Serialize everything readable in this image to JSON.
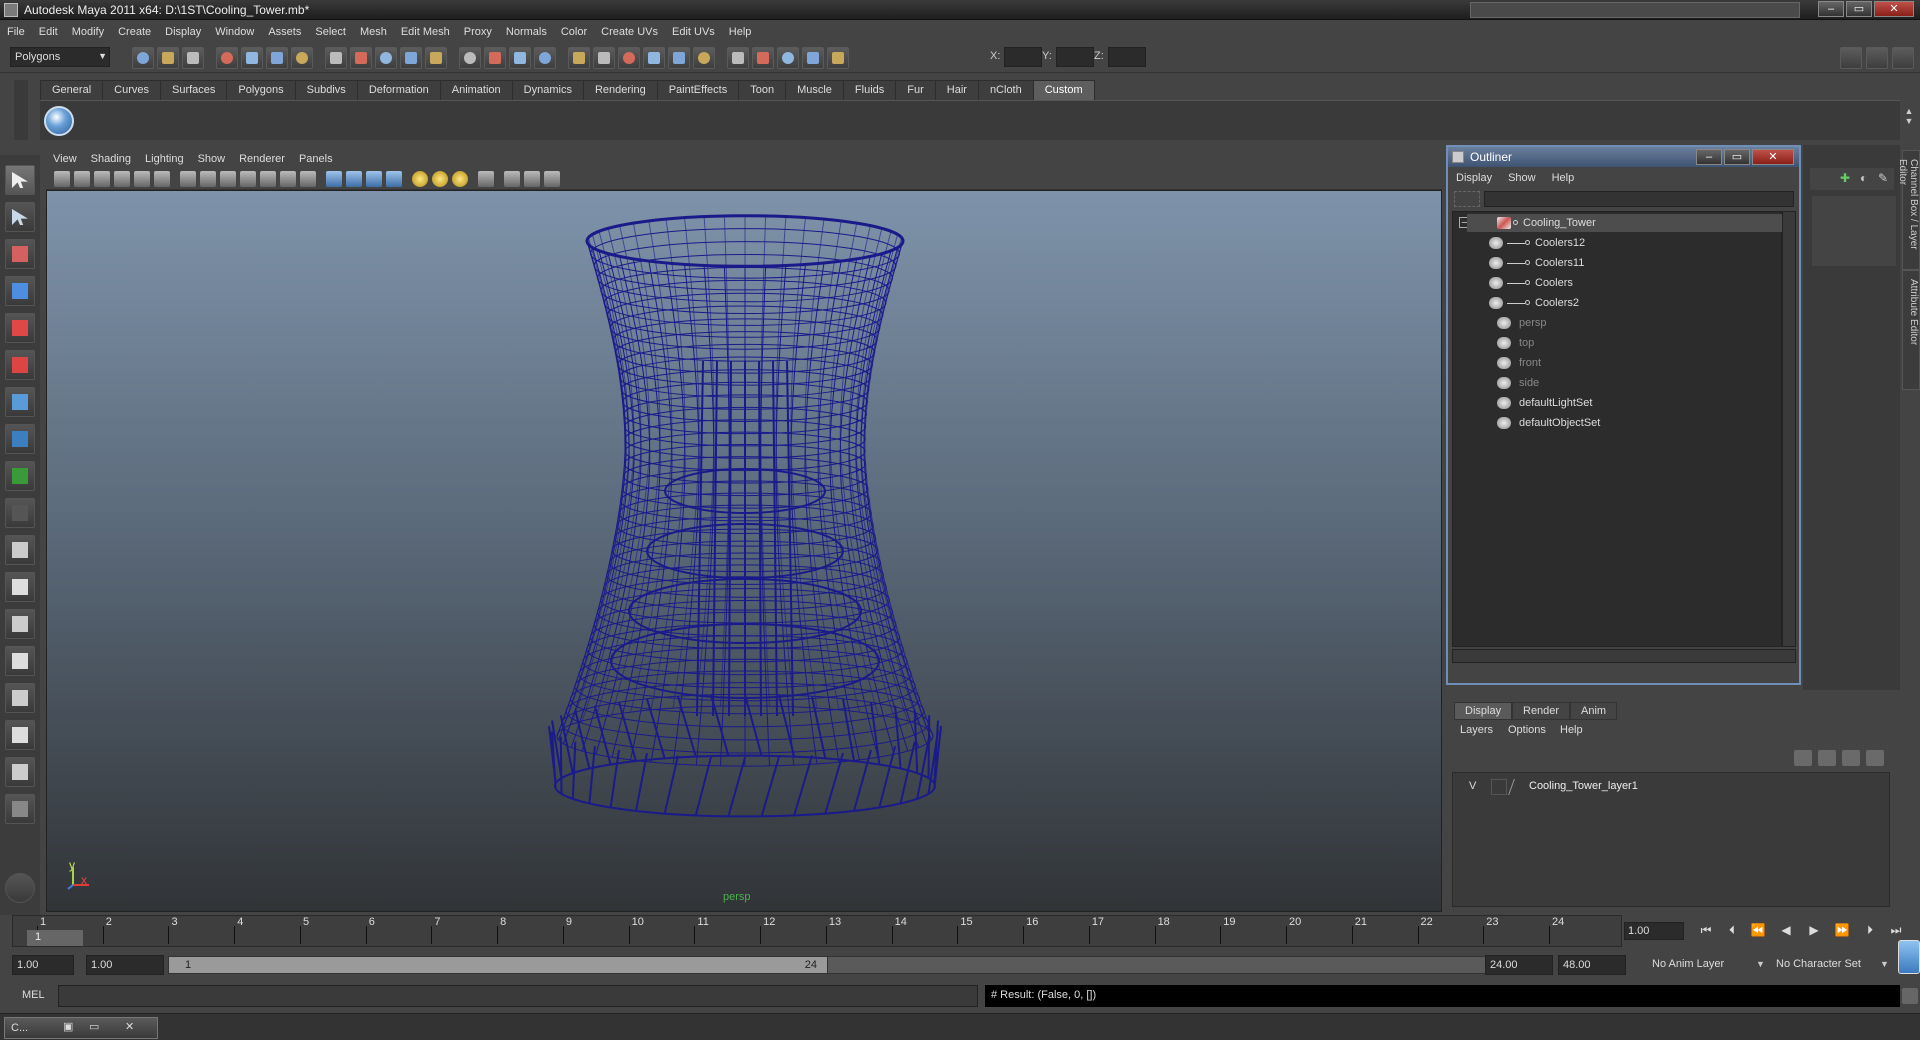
{
  "window": {
    "title": "Autodesk Maya 2011 x64: D:\\1ST\\Cooling_Tower.mb*",
    "controls": {
      "minimize": "–",
      "maximize": "▭",
      "close": "✕"
    }
  },
  "menubar": [
    "File",
    "Edit",
    "Modify",
    "Create",
    "Display",
    "Window",
    "Assets",
    "Select",
    "Mesh",
    "Edit Mesh",
    "Proxy",
    "Normals",
    "Color",
    "Create UVs",
    "Edit UVs",
    "Help"
  ],
  "statusline": {
    "mode": "Polygons",
    "x_label": "X:",
    "y_label": "Y:",
    "z_label": "Z:"
  },
  "shelf": {
    "tabs": [
      "General",
      "Curves",
      "Surfaces",
      "Polygons",
      "Subdivs",
      "Deformation",
      "Animation",
      "Dynamics",
      "Rendering",
      "PaintEffects",
      "Toon",
      "Muscle",
      "Fluids",
      "Fur",
      "Hair",
      "nCloth",
      "Custom"
    ],
    "active_tab": "Custom"
  },
  "viewport": {
    "menu": [
      "View",
      "Shading",
      "Lighting",
      "Show",
      "Renderer",
      "Panels"
    ],
    "camera": "persp",
    "axis_y": "y",
    "axis_x": "x",
    "wire_color": "#1a1a8a",
    "bg_top": "#7e93aa",
    "bg_bottom": "#313437"
  },
  "outliner": {
    "title": "Outliner",
    "menu": [
      "Display",
      "Show",
      "Help"
    ],
    "collapse_symbol": "–",
    "items": [
      {
        "label": "Cooling_Tower",
        "level": 0,
        "selected": true,
        "dim": false
      },
      {
        "label": "Coolers12",
        "level": 1,
        "selected": false,
        "dim": false
      },
      {
        "label": "Coolers11",
        "level": 1,
        "selected": false,
        "dim": false
      },
      {
        "label": "Coolers",
        "level": 1,
        "selected": false,
        "dim": false
      },
      {
        "label": "Coolers2",
        "level": 1,
        "selected": false,
        "dim": false
      },
      {
        "label": "persp",
        "level": 0,
        "selected": false,
        "dim": true
      },
      {
        "label": "top",
        "level": 0,
        "selected": false,
        "dim": true
      },
      {
        "label": "front",
        "level": 0,
        "selected": false,
        "dim": true
      },
      {
        "label": "side",
        "level": 0,
        "selected": false,
        "dim": true
      },
      {
        "label": "defaultLightSet",
        "level": 0,
        "selected": false,
        "dim": false
      },
      {
        "label": "defaultObjectSet",
        "level": 0,
        "selected": false,
        "dim": false
      }
    ]
  },
  "sidetabs": [
    "Channel Box / Layer Editor",
    "Attribute Editor"
  ],
  "layers": {
    "tabs": [
      "Display",
      "Render",
      "Anim"
    ],
    "active_tab": "Display",
    "menu": [
      "Layers",
      "Options",
      "Help"
    ],
    "rows": [
      {
        "visible": "V",
        "name": "Cooling_Tower_layer1"
      }
    ]
  },
  "timeline": {
    "start": 1,
    "end": 24,
    "current_frame_marker": "1",
    "current_time": "1.00"
  },
  "range": {
    "start_time": "1.00",
    "playback_start": "1.00",
    "slider_start": "1",
    "slider_end": "24",
    "playback_end": "24.00",
    "end_time": "48.00",
    "anim_layer": "No Anim Layer",
    "character_set": "No Character Set"
  },
  "commandline": {
    "label": "MEL",
    "result": "# Result: (False, 0, [])"
  },
  "taskbar": {
    "item": "C..."
  }
}
